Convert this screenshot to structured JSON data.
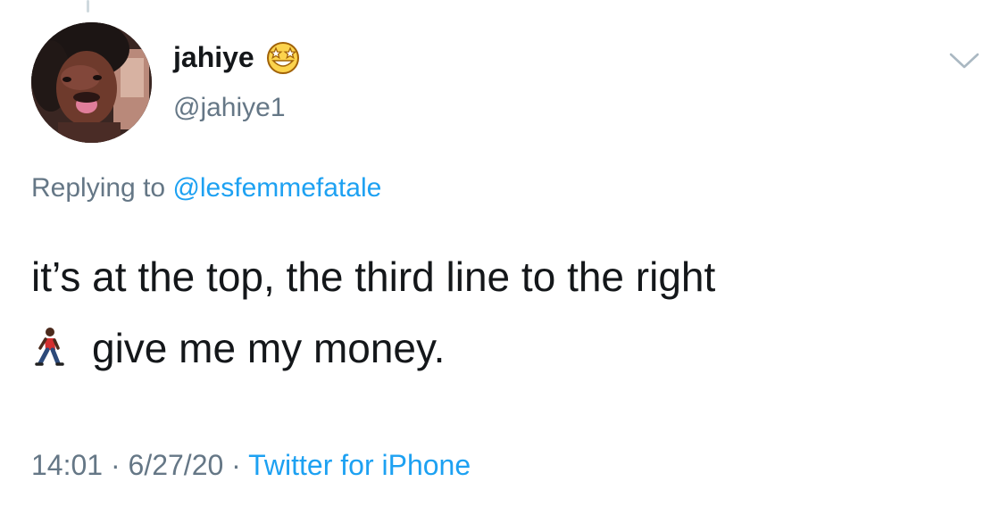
{
  "tweet": {
    "author": {
      "display_name": "jahiye",
      "name_emoji": "star-struck-emoji",
      "handle": "@jahiye1",
      "avatar": "profile-photo"
    },
    "menu_icon": "chevron-down-icon",
    "replying_prefix": "Replying to",
    "replying_to": "@lesfemmefatale",
    "text_line_1": "it’s at the top, the third line to the right",
    "text_line_2": "give me my money.",
    "text_emoji": "person-walking-emoji",
    "time": "14:01",
    "separator": "·",
    "date": "6/27/20",
    "source": "Twitter for iPhone"
  },
  "colors": {
    "text": "#14171a",
    "secondary": "#657786",
    "link": "#1da1f2"
  }
}
